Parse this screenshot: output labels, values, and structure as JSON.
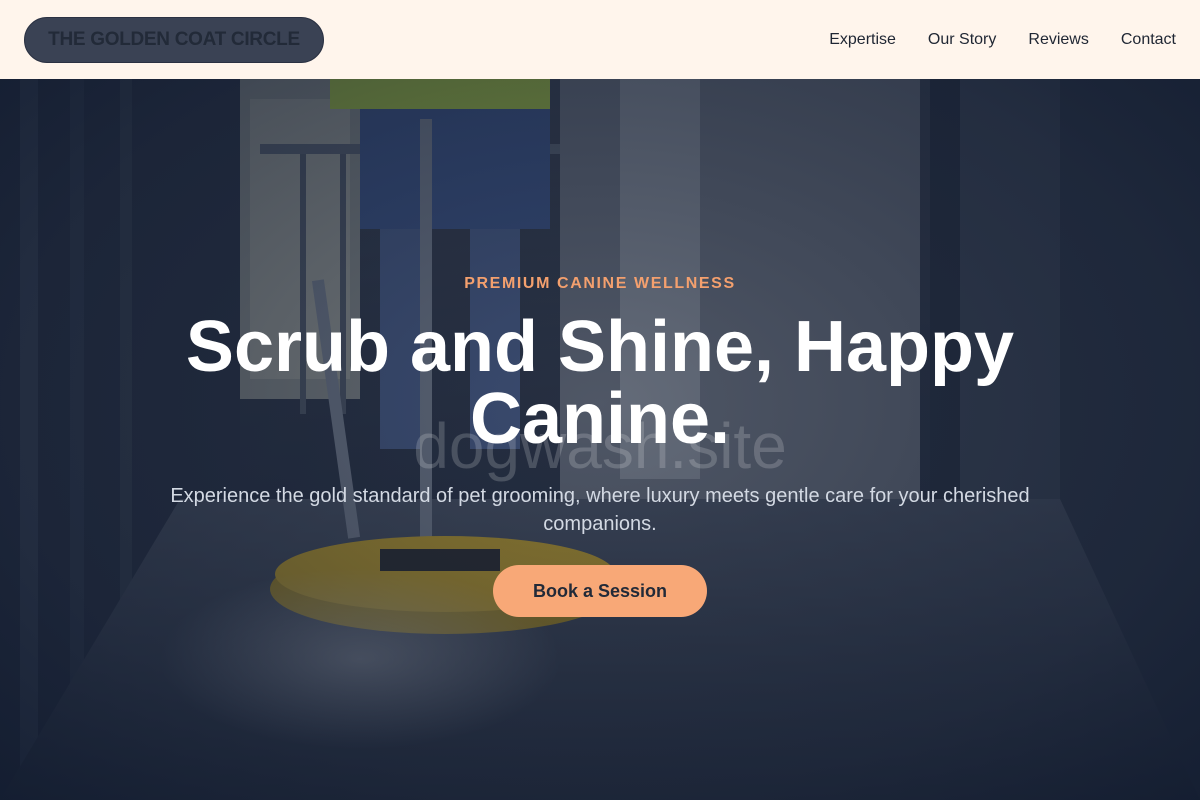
{
  "header": {
    "logo_text": "THE GOLDEN COAT CIRCLE",
    "nav": [
      "Expertise",
      "Our Story",
      "Reviews",
      "Contact"
    ]
  },
  "hero": {
    "eyebrow": "PREMIUM CANINE WELLNESS",
    "headline": "Scrub and Shine, Happy Canine.",
    "subtext": "Experience the gold standard of pet grooming, where luxury meets gentle care for your cherished companions.",
    "cta_label": "Book a Session",
    "watermark": "dogwash.site"
  },
  "colors": {
    "header_bg": "#fff5ec",
    "accent": "#f8a877",
    "eyebrow": "#f4a06e",
    "logo_pill": "#3a4254"
  }
}
